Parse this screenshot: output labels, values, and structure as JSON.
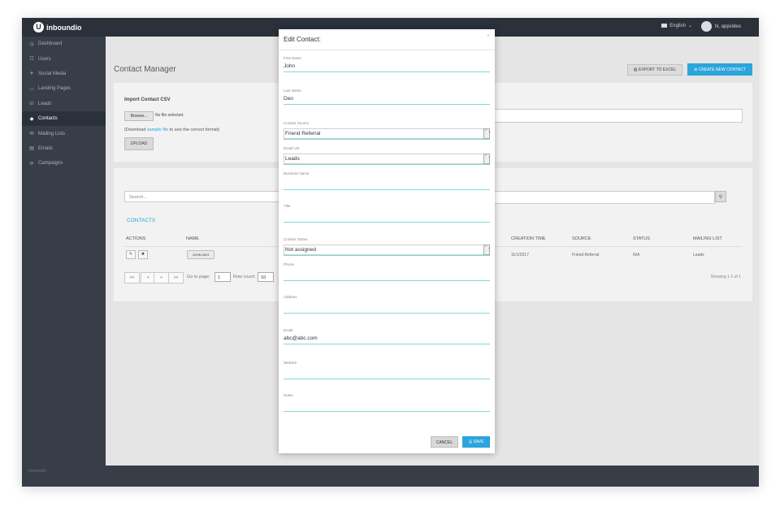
{
  "topbar": {
    "logo_mark": "U",
    "brand": "inboundio",
    "language": "English",
    "language_caret": "⌄",
    "user_name": "hi, appvideo"
  },
  "sidebar": {
    "items": [
      {
        "icon": "◷",
        "label": "Dashboard"
      },
      {
        "icon": "☷",
        "label": "Users"
      },
      {
        "icon": "✈",
        "label": "Social Media"
      },
      {
        "icon": "▭",
        "label": "Landing Pages"
      },
      {
        "icon": "☏",
        "label": "Leads"
      },
      {
        "icon": "◆",
        "label": "Contacts"
      },
      {
        "icon": "✉",
        "label": "Mailing Lists"
      },
      {
        "icon": "▤",
        "label": "Emails"
      },
      {
        "icon": "⟳",
        "label": "Campaigns"
      }
    ],
    "active_index": 5,
    "footer": "Inboundio"
  },
  "page": {
    "title": "Contact Manager",
    "export_label": "EXPORT TO EXCEL",
    "export_icon": "▨",
    "create_label": "CREATE NEW CONTACT",
    "create_icon": "⊕"
  },
  "import": {
    "title": "Import Contact CSV",
    "browse_label": "Browse...",
    "no_file": "No file selected.",
    "hint_prefix": "(Download",
    "hint_link": "sample file",
    "hint_suffix": "to see the correct format)",
    "upload_label": "UPLOAD"
  },
  "contacts": {
    "search_placeholder": "Search...",
    "search_icon": "⚲",
    "title": "CONTACTS",
    "columns": [
      "ACTIONS",
      "NAME",
      "CREATION TIME",
      "SOURCE",
      "STATUS",
      "MAILING LIST"
    ],
    "row": {
      "edit_icon": "✎",
      "delete_icon": "✖",
      "name": "JOHN DEO",
      "creation_time": "11/1/2017",
      "source": "Friend Referral",
      "status": "N/A",
      "mailing_list": "Leads"
    },
    "pagination": {
      "first": "<<",
      "prev": "<",
      "next": ">",
      "last": ">>",
      "goto_label": "Go to page:",
      "page_value": "1",
      "rowcount_label": "Row count:",
      "rowcount_value": "10"
    },
    "showing": "Showing 1-1 of 1"
  },
  "modal": {
    "title": "Edit Contact:",
    "close": "×",
    "fields": {
      "first_name": {
        "label": "First Name",
        "value": "John"
      },
      "last_name": {
        "label": "Last Name",
        "value": "Deo"
      },
      "contact_source": {
        "label": "Contact Source",
        "value": "Friend Referral"
      },
      "email_list": {
        "label": "Email List",
        "value": "Leads"
      },
      "business_name": {
        "label": "Business Name",
        "value": ""
      },
      "title": {
        "label": "Title",
        "value": ""
      },
      "contact_status": {
        "label": "Contact Status",
        "value": "Not assigned"
      },
      "phone": {
        "label": "Phone",
        "value": ""
      },
      "address": {
        "label": "Address",
        "value": ""
      },
      "email": {
        "label": "Email",
        "value": "abc@abc.com"
      },
      "website": {
        "label": "Website",
        "value": ""
      },
      "notes": {
        "label": "Notes",
        "value": ""
      }
    },
    "select_arrows": "⌃⌄",
    "cancel_label": "CANCEL",
    "save_label": "SAVE",
    "save_icon": "🖫"
  },
  "colors": {
    "accent": "#2ca4dc",
    "sidebar": "#373e48",
    "topbar": "#2a313b",
    "field_line": "#7fd9d8"
  }
}
